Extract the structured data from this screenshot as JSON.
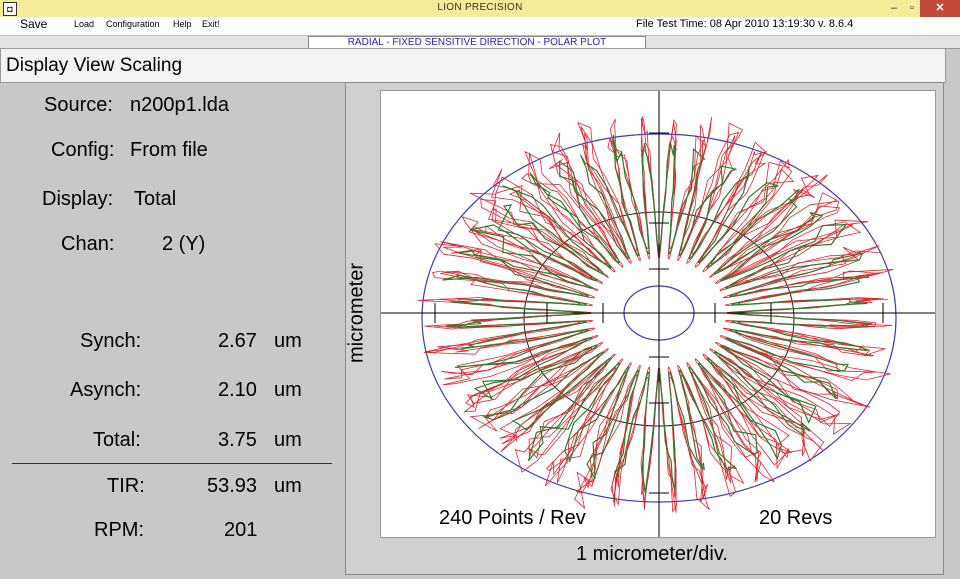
{
  "titlebar": {
    "title": "LION PRECISION",
    "min_glyph": "‒",
    "max_glyph": "▫",
    "close_glyph": "✕"
  },
  "menu": {
    "save": "Save",
    "load": "Load",
    "configuration": "Configuration",
    "help": "Help",
    "exit": "Exit!"
  },
  "file_info": "File Test Time: 08 Apr 2010  13:19:30   v. 8.6.4",
  "plot_mode": "RADIAL - FIXED SENSITIVE DIRECTION - POLAR PLOT",
  "scaling_label": "Display View Scaling",
  "info": {
    "source_label": "Source:",
    "source_value": "n200p1.lda",
    "config_label": "Config:",
    "config_value": "From file",
    "display_label": "Display:",
    "display_value": "Total",
    "chan_label": "Chan:",
    "chan_value": "2 (Y)",
    "synch_label": "Synch:",
    "synch_value": "2.67",
    "asynch_label": "Asynch:",
    "asynch_value": "2.10",
    "total_label": "Total:",
    "total_value": "3.75",
    "tir_label": "TIR:",
    "tir_value": "53.93",
    "rpm_label": "RPM:",
    "rpm_value": "201",
    "unit": "um"
  },
  "plot": {
    "ylabel": "micrometer",
    "xlabel": "1 micrometer/div.",
    "points_label": "240 Points / Rev",
    "revs_label": "20 Revs",
    "colors": {
      "outer_circle": "#3a3acc",
      "inner_circle": "#3a3acc",
      "trace_red": "#e8202a",
      "trace_green": "#2e7d2e",
      "axes": "#000000"
    }
  }
}
